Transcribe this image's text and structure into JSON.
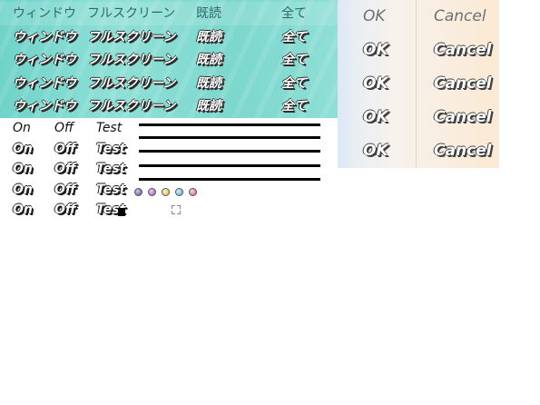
{
  "menu": {
    "rows": [
      {
        "window": "ウィンドウ",
        "fullscreen": "フルスクリーン",
        "read": "既読",
        "all": "全て"
      },
      {
        "window": "ウィンドウ",
        "fullscreen": "フルスクリーン",
        "read": "既読",
        "all": "全て"
      },
      {
        "window": "ウィンドウ",
        "fullscreen": "フルスクリーン",
        "read": "既読",
        "all": "全て"
      },
      {
        "window": "ウィンドウ",
        "fullscreen": "フルスクリーン",
        "read": "既読",
        "all": "全て"
      },
      {
        "window": "ウィンドウ",
        "fullscreen": "フルスクリーン",
        "read": "既読",
        "all": "全て"
      }
    ]
  },
  "buttons": {
    "rows": [
      {
        "ok": "OK",
        "cancel": "Cancel"
      },
      {
        "ok": "OK",
        "cancel": "Cancel"
      },
      {
        "ok": "OK",
        "cancel": "Cancel"
      },
      {
        "ok": "OK",
        "cancel": "Cancel"
      },
      {
        "ok": "OK",
        "cancel": "Cancel"
      }
    ]
  },
  "toggles": {
    "rows": [
      {
        "on": "On",
        "off": "Off",
        "test": "Test"
      },
      {
        "on": "On",
        "off": "Off",
        "test": "Test"
      },
      {
        "on": "On",
        "off": "Off",
        "test": "Test"
      },
      {
        "on": "On",
        "off": "Off",
        "test": "Test"
      },
      {
        "on": "On",
        "off": "Off",
        "test": "Test"
      }
    ]
  },
  "icons": {
    "orbs": [
      "orb-dark",
      "orb-violet",
      "orb-yellow",
      "orb-blue",
      "orb-pink"
    ],
    "cursor": "cursor-block-icon",
    "crop": "crop-frame-icon"
  },
  "colors": {
    "menu_teal": "#7cd7cd",
    "button_peach": "#fbe9d4",
    "outline": "#2a2a2a"
  }
}
